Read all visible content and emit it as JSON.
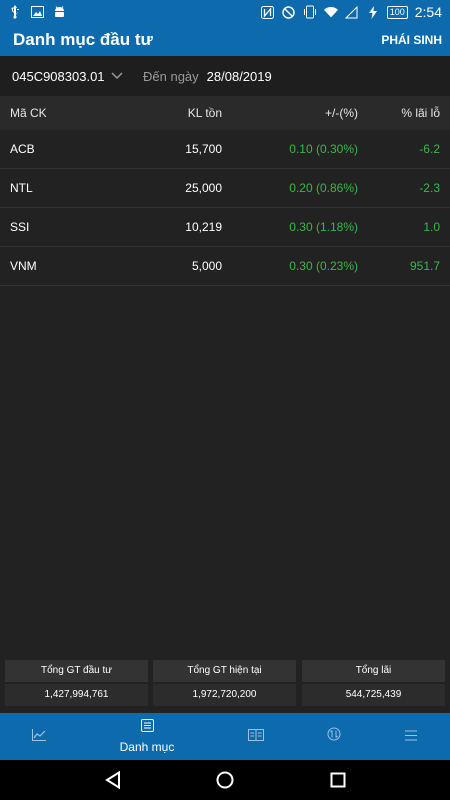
{
  "status_bar": {
    "time": "2:54",
    "battery": "100",
    "left_icons": [
      "usb-icon",
      "image-icon",
      "android-icon"
    ],
    "right_icons": [
      "nfc-icon",
      "dnd-icon",
      "vibrate-icon",
      "wifi-icon",
      "signal-icon",
      "charging-icon"
    ]
  },
  "app_bar": {
    "title": "Danh mục đầu tư",
    "action": "PHÁI SINH"
  },
  "filter": {
    "account": "045C908303.01",
    "date_label": "Đến ngày",
    "date": "28/08/2019"
  },
  "table": {
    "headers": [
      "Mã CK",
      "KL tồn",
      "+/-(%)",
      "% lãi lỗ"
    ],
    "rows": [
      {
        "symbol": "ACB",
        "qty": "15,700",
        "change": "0.10 (0.30%)",
        "pl": "-6.2"
      },
      {
        "symbol": "NTL",
        "qty": "25,000",
        "change": "0.20 (0.86%)",
        "pl": "-2.3"
      },
      {
        "symbol": "SSI",
        "qty": "10,219",
        "change": "0.30 (1.18%)",
        "pl": "1.0"
      },
      {
        "symbol": "VNM",
        "qty": "5,000",
        "change": "0.30 (0.23%)",
        "pl": "951.7"
      }
    ]
  },
  "summary": [
    {
      "label": "Tổng GT đầu tư",
      "value": "1,427,994,761"
    },
    {
      "label": "Tổng GT hiện tại",
      "value": "1,972,720,200"
    },
    {
      "label": "Tổng lãi",
      "value": "544,725,439"
    }
  ],
  "bottom_nav": {
    "items": [
      {
        "icon": "chart-icon",
        "label": ""
      },
      {
        "icon": "portfolio-icon",
        "label": "Danh mục"
      },
      {
        "icon": "book-icon",
        "label": ""
      },
      {
        "icon": "exchange-icon",
        "label": ""
      },
      {
        "icon": "menu-icon",
        "label": ""
      }
    ]
  },
  "colors": {
    "primary": "#0d6aac",
    "background": "#222222",
    "positive": "#3cb54a"
  }
}
